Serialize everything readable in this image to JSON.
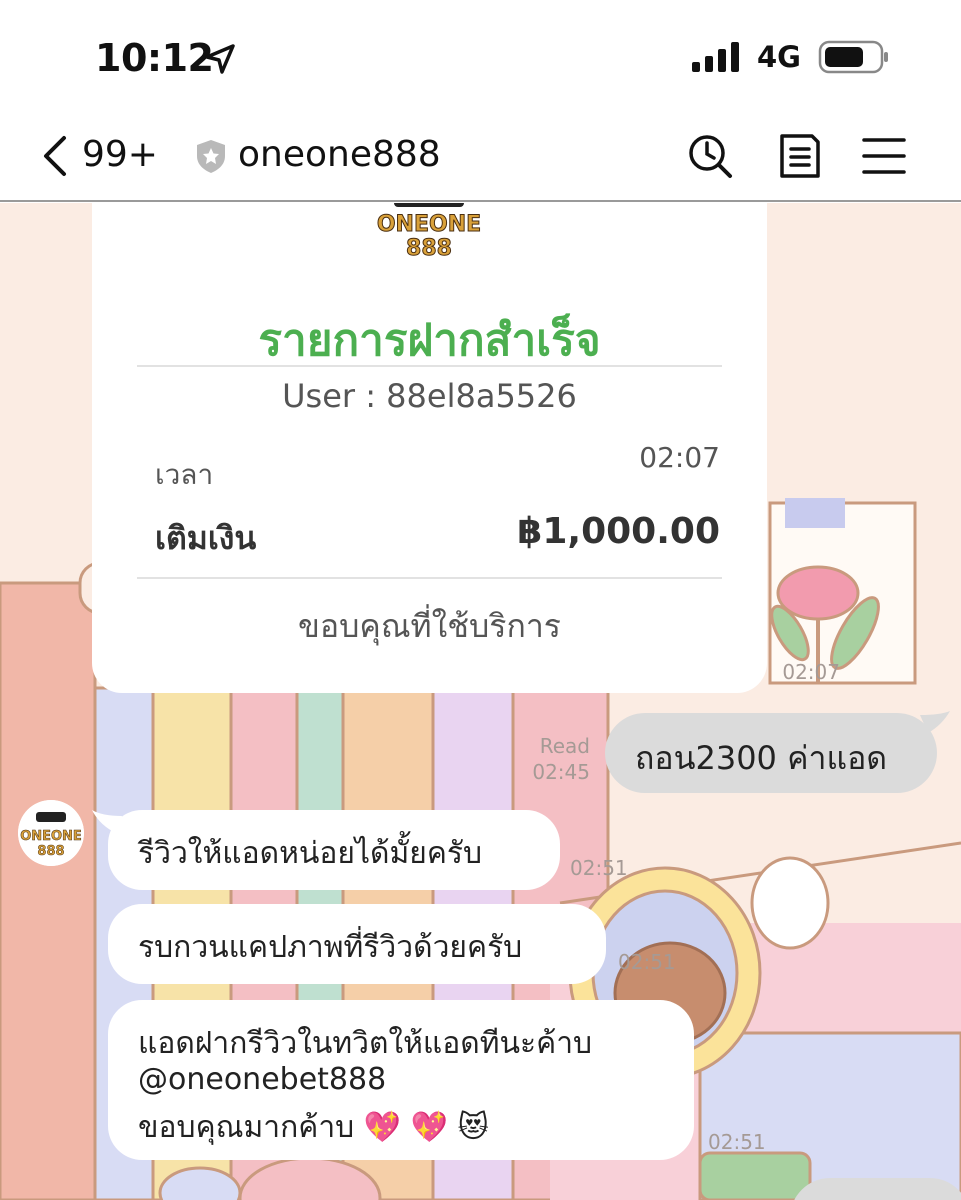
{
  "status_bar": {
    "time": "10:12",
    "network": "4G",
    "icons": [
      "location-arrow-icon",
      "signal-bars-icon",
      "battery-icon"
    ]
  },
  "header": {
    "unread_count": "99+",
    "chat_name": "oneone888",
    "icons": [
      "chevron-left-icon",
      "shield-icon",
      "search-icon",
      "notes-icon",
      "menu-icon"
    ]
  },
  "receipt": {
    "logo_text_top": "ONEONE",
    "logo_text_bottom": "888",
    "title": "รายการฝากสำเร็จ",
    "user": "User : 88el8a5526",
    "time_label": "เวลา",
    "time_value": "02:07",
    "amount_label": "เติมเงิน",
    "amount_value": "฿1,000.00",
    "thanks": "ขอบคุณที่ใช้บริการ"
  },
  "messages": {
    "receipt_time": "02:07",
    "outgoing": {
      "read_label": "Read",
      "time": "02:45",
      "text": "ถอน2300 ค่าแอด"
    },
    "incoming": [
      {
        "time": "02:51",
        "text": "รีวิวให้แอดหน่อยได้มั้ยครับ"
      },
      {
        "time": "02:51",
        "text": "รบกวนแคปภาพที่รีวิวด้วยครับ"
      },
      {
        "time": "02:51",
        "line1": "แอดฝากรีวิวในทวิตให้แอดทีนะค้าบ",
        "line2": "@oneonebet888",
        "line3": "ขอบคุณมากค้าบ",
        "emoji1": "💖",
        "emoji2": "💖",
        "emoji3": "😻"
      }
    ],
    "avatar_logo_top": "ONEONE",
    "avatar_logo_bottom": "888"
  },
  "colors": {
    "success_green": "#4caf50",
    "outgoing_bubble": "#dbdbdb",
    "wallpaper": "#fbece3"
  }
}
